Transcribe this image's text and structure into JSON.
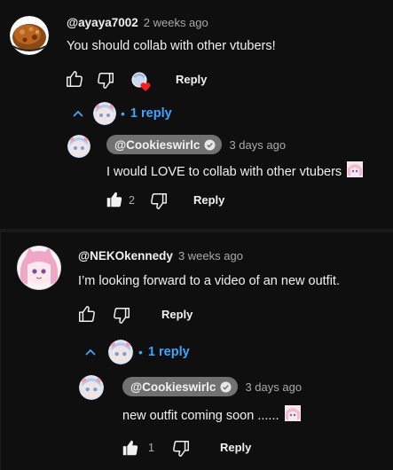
{
  "comments": [
    {
      "author": "@ayaya7002",
      "time": "2 weeks ago",
      "text": "You should collab with other vtubers!",
      "reply_label": "Reply",
      "replies_toggle": "1 reply",
      "replies": [
        {
          "author": "@Cookieswirlc",
          "time": "3 days ago",
          "text": "I would LOVE to collab with other vtubers",
          "likes": "2",
          "reply_label": "Reply"
        }
      ]
    },
    {
      "author": "@NEKOkennedy",
      "time": "3 weeks ago",
      "text": "I’m looking forward to a video of an new outfit.",
      "reply_label": "Reply",
      "replies_toggle": "1 reply",
      "replies": [
        {
          "author": "@Cookieswirlc",
          "time": "3 days ago",
          "text": "new outfit coming soon ......",
          "likes": "1",
          "reply_label": "Reply"
        }
      ]
    }
  ],
  "icons": {
    "like": "thumbs-up-icon",
    "dislike": "thumbs-down-icon",
    "collapse": "chevron-up-icon",
    "verified": "checkmark-badge-icon",
    "heart": "creator-heart-icon"
  },
  "colors": {
    "background": "#0f0f0f",
    "link": "#3ea6ff",
    "muted": "#aaaaaa",
    "chip": "#717171",
    "heart": "#ff0000"
  }
}
